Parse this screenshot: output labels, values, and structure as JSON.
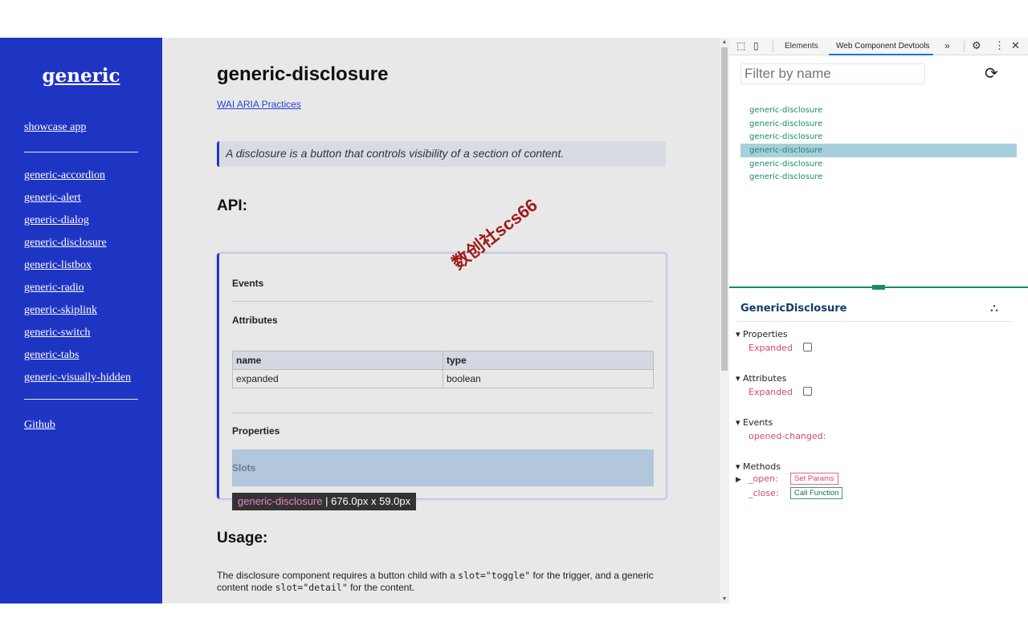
{
  "sidebar": {
    "brand": "generic",
    "showcase": "showcase app",
    "components": [
      "generic-accordion",
      "generic-alert",
      "generic-dialog",
      "generic-disclosure",
      "generic-listbox",
      "generic-radio",
      "generic-skiplink",
      "generic-switch",
      "generic-tabs",
      "generic-visually-hidden"
    ],
    "github": "Github"
  },
  "main": {
    "title": "generic-disclosure",
    "aria_link": "WAI ARIA Practices",
    "description": "A disclosure is a button that controls visibility of a section of content.",
    "api_heading": "API:",
    "events_label": "Events",
    "attributes_label": "Attributes",
    "table": {
      "headers": [
        "name",
        "type"
      ],
      "rows": [
        [
          "expanded",
          "boolean"
        ]
      ]
    },
    "properties_label": "Properties",
    "slots_label": "Slots",
    "tooltip": {
      "tag": "generic-disclosure",
      "dims": " | 676.0px x 59.0px"
    },
    "usage_heading": "Usage:",
    "usage": {
      "t1": "The disclosure component requires a button child with a ",
      "c1": "slot=\"toggle\"",
      "t2": " for the trigger, and a generic content node ",
      "c2": "slot=\"detail\"",
      "t3": " for the content."
    },
    "watermark": "数创社scs66"
  },
  "devtools": {
    "tabs": {
      "elements": "Elements",
      "wcd": "Web Component Devtools",
      "more": "»"
    },
    "filter_placeholder": "Filter by name",
    "tree": [
      {
        "label": "generic-disclosure",
        "selected": false
      },
      {
        "label": "generic-disclosure",
        "selected": false
      },
      {
        "label": "generic-disclosure",
        "selected": false
      },
      {
        "label": "generic-disclosure",
        "selected": true
      },
      {
        "label": "generic-disclosure",
        "selected": false
      },
      {
        "label": "generic-disclosure",
        "selected": false
      }
    ],
    "detail_title": "GenericDisclosure",
    "properties": {
      "label": "▾ Properties",
      "key": "Expanded",
      "checked": false
    },
    "attributes": {
      "label": "▾ Attributes",
      "key": "Expanded",
      "checked": false
    },
    "events": {
      "label": "▾ Events",
      "key": "opened-changed:"
    },
    "methods": {
      "label": "▾ Methods",
      "open_key": "_open:",
      "open_btn": "Set Params",
      "close_key": "_close:",
      "close_btn": "Call Function"
    },
    "colors": {
      "accent_green": "#1a8a6d",
      "selected_bg": "#a8cfdc",
      "key_red": "#d04a6a"
    }
  }
}
